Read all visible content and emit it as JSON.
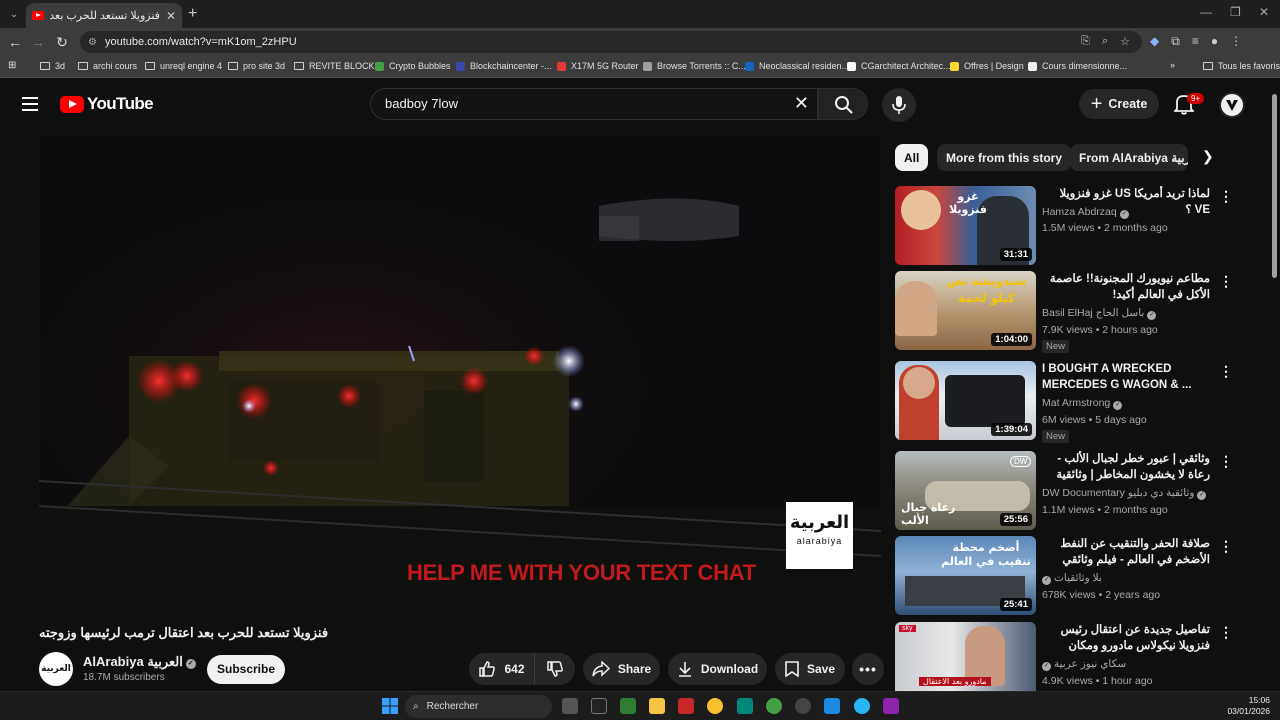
{
  "browser": {
    "tab_title": "فنزويلا تستعد للحرب بعد (64)",
    "url": "youtube.com/watch?v=mK1om_2zHPU",
    "bookmarks": [
      "3d",
      "archi cours",
      "unreql engine 4",
      "pro site 3d",
      "REVITE BLOCKS",
      "Crypto Bubbles",
      "Blockchaincenter -...",
      "X17M 5G Router",
      "Browse Torrents :: C...",
      "Neoclassical residen...",
      "CGarchitect Architec...",
      "Offres | Design",
      "Cours dimensionne...",
      "Tous les favoris"
    ]
  },
  "header": {
    "logo": "YouTube",
    "search_value": "badboy 7low",
    "create_label": "Create",
    "notif_badge": "9+"
  },
  "player": {
    "caption": "HELP ME WITH YOUR TEXT CHAT",
    "logo_arabic": "العربية",
    "logo_latin": "alarabiya"
  },
  "video": {
    "title": "فنزويلا تستعد للحرب بعد اعتقال ترمب لرئيسها وزوجته",
    "channel": "AlArabiya العربية",
    "subscribers": "18.7M subscribers",
    "subscribe_label": "Subscribe",
    "likes": "642",
    "share_label": "Share",
    "download_label": "Download",
    "save_label": "Save"
  },
  "chips": [
    "All",
    "More from this story",
    "From AlArabiya العربية"
  ],
  "recommendations": [
    {
      "title": "لماذا تريد أمريكا US غزو فنزويلا VE ؟",
      "channel": "Hamza Abdrzaq",
      "views": "1.5M views",
      "age": "2 months ago",
      "duration": "31:31",
      "badge": "",
      "thumb_text": "غزو فنزويلا"
    },
    {
      "title": "مطاعم نيويورك المجنونة!! عاصمة الأكل في العالم أكيد!",
      "channel": "Basil ElHaj باسل الحاج",
      "views": "7.9K views",
      "age": "2 hours ago",
      "duration": "1:04:00",
      "badge": "New",
      "thumb_text": "سندويشة نص كيلو لحمة"
    },
    {
      "title": "I BOUGHT A WRECKED MERCEDES G WAGON & ...",
      "channel": "Mat Armstrong",
      "views": "6M views",
      "age": "5 days ago",
      "duration": "1:39:04",
      "badge": "New",
      "thumb_text": ""
    },
    {
      "title": "وثائقي | عبور خطر لجبال الألب - رعاة لا يخشون المخاطر | وثائقية دي دبليو",
      "channel": "DW Documentary وثائقية دي دبليو",
      "views": "1.1M views",
      "age": "2 months ago",
      "duration": "25:56",
      "badge": "",
      "thumb_text": "رعاة جبال الألب"
    },
    {
      "title": "صلافة الحفر والتنقيب عن النفط الأضخم في العالم - فيلم وثائقي",
      "channel": "بلا وثائقيات",
      "views": "678K views",
      "age": "2 years ago",
      "duration": "25:41",
      "badge": "",
      "thumb_text": "أضخم محطة تنقيب في العالم"
    },
    {
      "title": "تفاصيل جديدة عن اعتقال رئيس فنزويلا نيكولاس مادورو ومكان تواجده",
      "channel": "سكاي نيوز عربية",
      "views": "4.9K views",
      "age": "1 hour ago",
      "duration": "",
      "badge": "",
      "thumb_text": "مادورو بعد الاعتقال"
    }
  ],
  "taskbar": {
    "search_label": "Rechercher",
    "time": "15:06",
    "date": "03/01/2026"
  }
}
